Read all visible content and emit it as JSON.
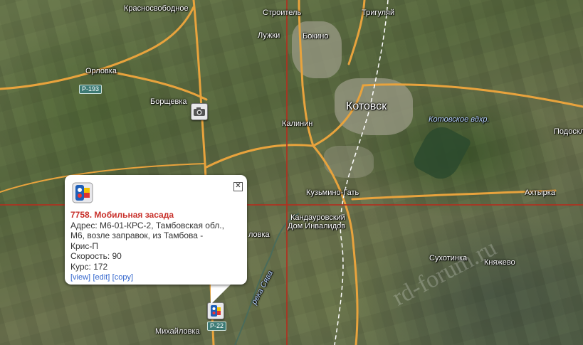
{
  "map": {
    "places": [
      {
        "id": "krasnosvobodnoe",
        "name": "Красносвободное"
      },
      {
        "id": "stroitel",
        "name": "Строитель"
      },
      {
        "id": "trigulyay",
        "name": "Тригуляй"
      },
      {
        "id": "luzhki",
        "name": "Лужки"
      },
      {
        "id": "bokino",
        "name": "Бокино"
      },
      {
        "id": "orlovka",
        "name": "Орловка"
      },
      {
        "id": "borshchevka",
        "name": "Борщевка"
      },
      {
        "id": "kotovsk",
        "name": "Котовск"
      },
      {
        "id": "kalinin",
        "name": "Калинин"
      },
      {
        "id": "podoskl",
        "name": "Подоскл"
      },
      {
        "id": "kuzmino_gat",
        "name": "Кузьмино-Гать"
      },
      {
        "id": "akhtyrka",
        "name": "Ахтырка"
      },
      {
        "id": "kandaurovsky",
        "name": "Кандауровский"
      },
      {
        "id": "dom_invalidov",
        "name": "Дом Инвалидов"
      },
      {
        "id": "lovka_partial",
        "name": "ловка"
      },
      {
        "id": "sukhotinka",
        "name": "Сухотинка"
      },
      {
        "id": "knyazhevo",
        "name": "Княжево"
      },
      {
        "id": "mikhaylovka",
        "name": "Михайловка"
      }
    ],
    "water_labels": [
      {
        "id": "reservoir",
        "name": "Котовское вдхр."
      },
      {
        "id": "river",
        "name": "река Сява"
      }
    ],
    "road_shields": [
      {
        "id": "r193",
        "label": "Р-193"
      },
      {
        "id": "r22",
        "label": "Р-22"
      }
    ],
    "watermark": "rd-forum.ru",
    "colors": {
      "road": "#e8a33d",
      "railway": "#ffffff",
      "crosshair": "#b03020",
      "popup_title": "#c8302a",
      "link": "#3366cc"
    }
  },
  "markers": [
    {
      "id": "camera",
      "icon": "camera-icon"
    },
    {
      "id": "mobile_ambush",
      "icon": "mobile-ambush-icon"
    }
  ],
  "popup": {
    "icon": "mobile-ambush-icon",
    "title": "7758. Мобильная засада",
    "address_line1": "Адрес: М6-01-КРС-2, Тамбовская обл.,",
    "address_line2": "М6, возле заправок, из Тамбова -",
    "address_line3": "Крис-П",
    "speed_label": "Скорость",
    "speed_value": ": 90",
    "course": "Курс: 172",
    "links": {
      "view": "[view]",
      "edit": "[edit]",
      "copy": "[copy]"
    },
    "close": "✕"
  }
}
